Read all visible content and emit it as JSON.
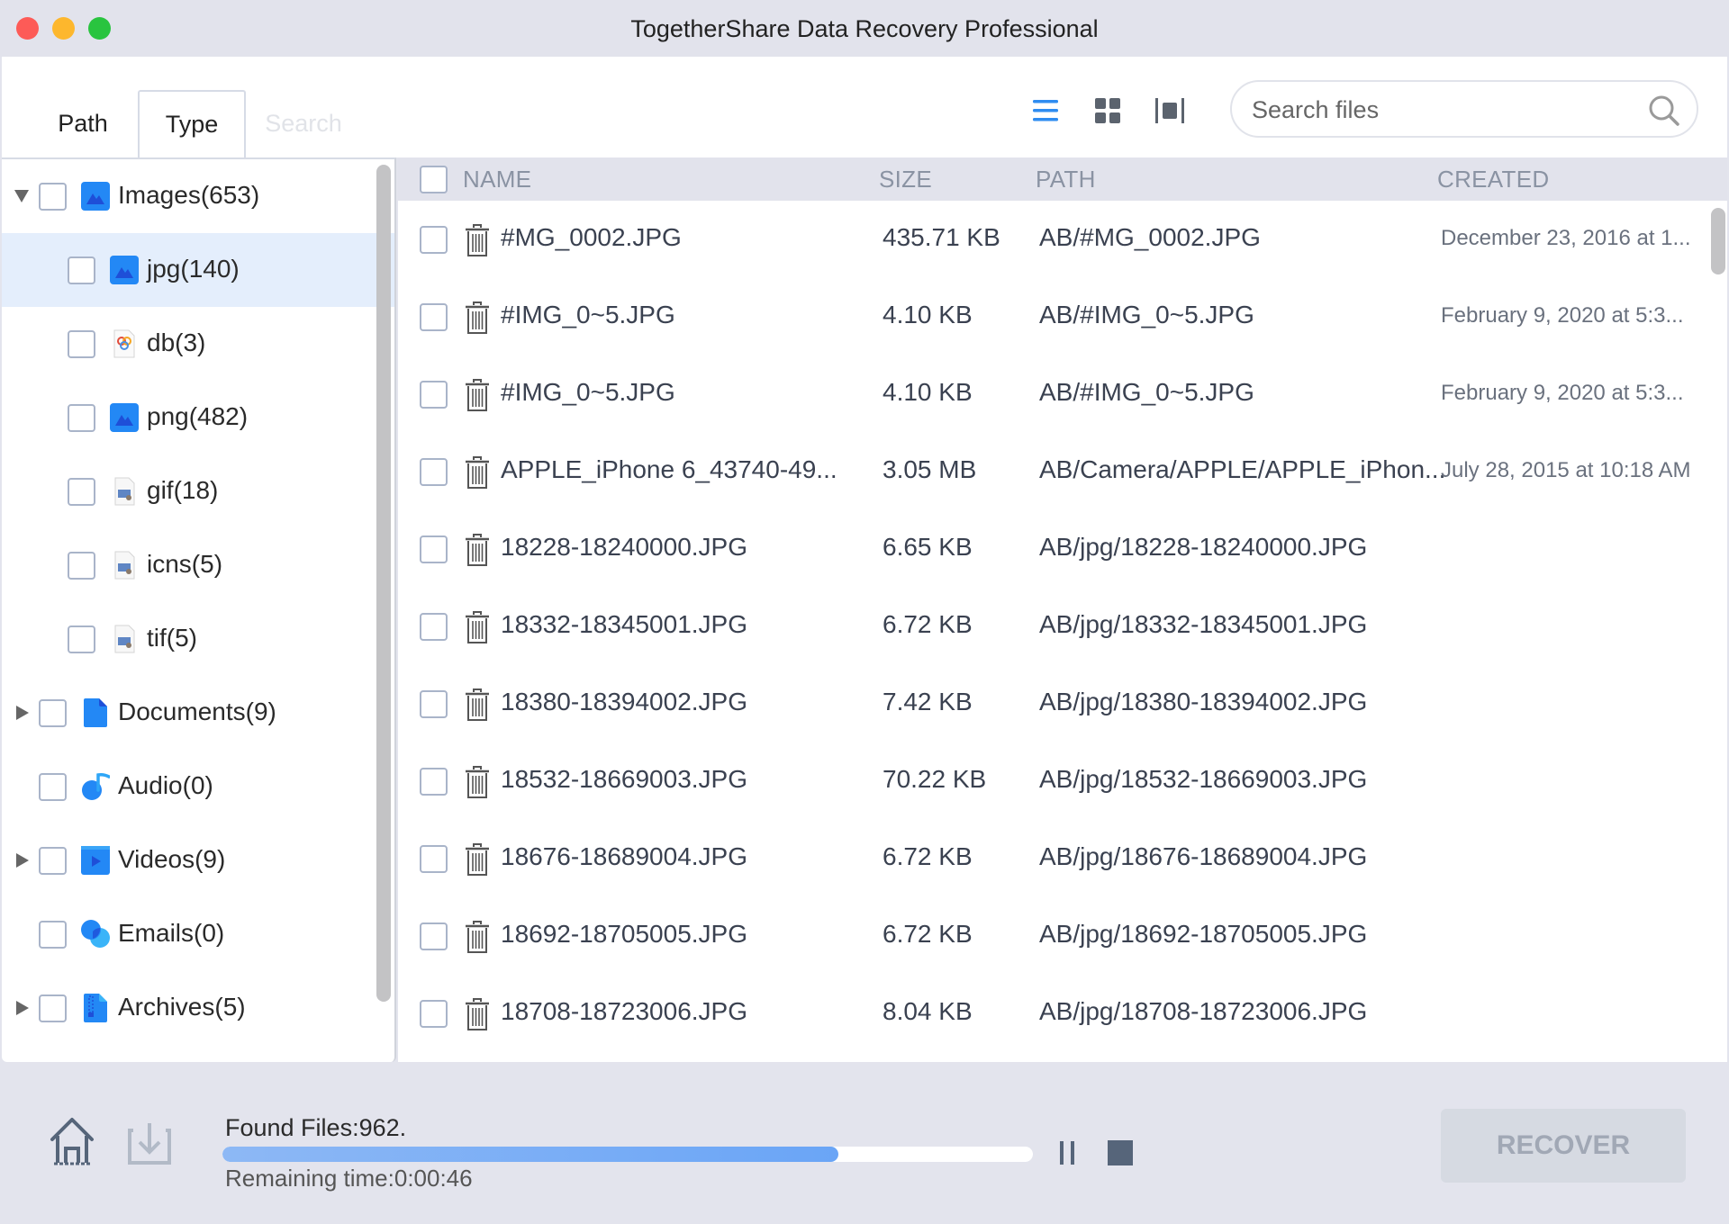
{
  "window": {
    "title": "TogetherShare Data Recovery Professional"
  },
  "toolbar": {
    "tabs": [
      {
        "label": "Path",
        "active": false
      },
      {
        "label": "Type",
        "active": true
      },
      {
        "label": "Search",
        "active": false,
        "disabled": true
      }
    ],
    "view_modes": [
      {
        "icon": "list-view-icon",
        "active": true
      },
      {
        "icon": "grid-view-icon",
        "active": false
      },
      {
        "icon": "preview-view-icon",
        "active": false
      }
    ],
    "search": {
      "placeholder": "Search files",
      "value": ""
    }
  },
  "sidebar": {
    "items": [
      {
        "label": "Images(653)",
        "level": 0,
        "expanded": true,
        "icon": "image-icon",
        "checked": false,
        "selected": false
      },
      {
        "label": "jpg(140)",
        "level": 1,
        "icon": "image-icon",
        "checked": false,
        "selected": true
      },
      {
        "label": "db(3)",
        "level": 1,
        "icon": "db-file-icon",
        "checked": false,
        "selected": false
      },
      {
        "label": "png(482)",
        "level": 1,
        "icon": "image-icon",
        "checked": false,
        "selected": false
      },
      {
        "label": "gif(18)",
        "level": 1,
        "icon": "generic-image-file-icon",
        "checked": false,
        "selected": false
      },
      {
        "label": "icns(5)",
        "level": 1,
        "icon": "generic-image-file-icon",
        "checked": false,
        "selected": false
      },
      {
        "label": "tif(5)",
        "level": 1,
        "icon": "generic-image-file-icon",
        "checked": false,
        "selected": false
      },
      {
        "label": "Documents(9)",
        "level": 0,
        "expanded": false,
        "icon": "document-icon",
        "checked": false,
        "selected": false
      },
      {
        "label": "Audio(0)",
        "level": 0,
        "icon": "audio-icon",
        "checked": false,
        "selected": false
      },
      {
        "label": "Videos(9)",
        "level": 0,
        "expanded": false,
        "icon": "video-icon",
        "checked": false,
        "selected": false
      },
      {
        "label": "Emails(0)",
        "level": 0,
        "icon": "email-icon",
        "checked": false,
        "selected": false
      },
      {
        "label": "Archives(5)",
        "level": 0,
        "expanded": false,
        "icon": "archive-icon",
        "checked": false,
        "selected": false
      }
    ]
  },
  "file_list": {
    "columns": [
      "NAME",
      "SIZE",
      "PATH",
      "CREATED"
    ],
    "rows": [
      {
        "name": "#MG_0002.JPG",
        "size": "435.71 KB",
        "path": "AB/#MG_0002.JPG",
        "created": "December 23, 2016 at 1..."
      },
      {
        "name": "#IMG_0~5.JPG",
        "size": "4.10 KB",
        "path": "AB/#IMG_0~5.JPG",
        "created": "February 9, 2020 at 5:3..."
      },
      {
        "name": "#IMG_0~5.JPG",
        "size": "4.10 KB",
        "path": "AB/#IMG_0~5.JPG",
        "created": "February 9, 2020 at 5:3..."
      },
      {
        "name": "APPLE_iPhone 6_43740-49...",
        "size": "3.05 MB",
        "path": "AB/Camera/APPLE/APPLE_iPhon...",
        "created": "July 28, 2015 at 10:18 AM"
      },
      {
        "name": "18228-18240000.JPG",
        "size": "6.65 KB",
        "path": "AB/jpg/18228-18240000.JPG",
        "created": ""
      },
      {
        "name": "18332-18345001.JPG",
        "size": "6.72 KB",
        "path": "AB/jpg/18332-18345001.JPG",
        "created": ""
      },
      {
        "name": "18380-18394002.JPG",
        "size": "7.42 KB",
        "path": "AB/jpg/18380-18394002.JPG",
        "created": ""
      },
      {
        "name": "18532-18669003.JPG",
        "size": "70.22 KB",
        "path": "AB/jpg/18532-18669003.JPG",
        "created": ""
      },
      {
        "name": "18676-18689004.JPG",
        "size": "6.72 KB",
        "path": "AB/jpg/18676-18689004.JPG",
        "created": ""
      },
      {
        "name": "18692-18705005.JPG",
        "size": "6.72 KB",
        "path": "AB/jpg/18692-18705005.JPG",
        "created": ""
      },
      {
        "name": "18708-18723006.JPG",
        "size": "8.04 KB",
        "path": "AB/jpg/18708-18723006.JPG",
        "created": ""
      }
    ]
  },
  "footer": {
    "found_files": "Found Files:962.",
    "remaining_time": "Remaining time:0:00:46",
    "progress_fraction": 0.76,
    "recover_label": "RECOVER",
    "recover_enabled": false
  },
  "colors": {
    "accent": "#2f8cf0",
    "icon_blue": "#2388f5",
    "selected_row": "#e4eefc",
    "header_band": "#e2e3ec"
  }
}
